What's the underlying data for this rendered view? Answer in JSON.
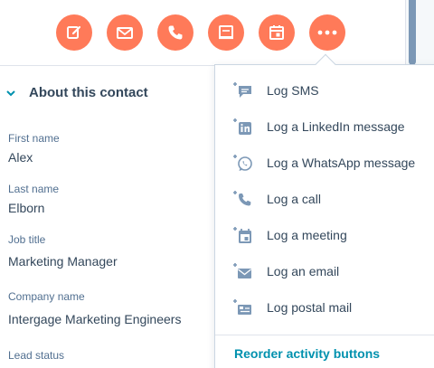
{
  "action_buttons": [
    {
      "name": "note",
      "icon": "note-icon"
    },
    {
      "name": "email",
      "icon": "email-icon"
    },
    {
      "name": "call",
      "icon": "phone-icon"
    },
    {
      "name": "task",
      "icon": "task-icon"
    },
    {
      "name": "meeting",
      "icon": "meeting-icon"
    },
    {
      "name": "more",
      "icon": "more-icon"
    }
  ],
  "colors": {
    "accent": "#ff7a59",
    "icon_slate": "#7c98b6",
    "link": "#0091ae",
    "text": "#33475b"
  },
  "about": {
    "title": "About this contact",
    "fields": [
      {
        "label": "First name",
        "value": "Alex"
      },
      {
        "label": "Last name",
        "value": "Elborn"
      },
      {
        "label": "Job title",
        "value": "Marketing Manager"
      },
      {
        "label": "Company name",
        "value": "Intergage Marketing Engineers"
      },
      {
        "label": "Lead status",
        "value": ""
      }
    ]
  },
  "menu": {
    "items": [
      {
        "label": "Log SMS",
        "icon": "sms-icon"
      },
      {
        "label": "Log a LinkedIn message",
        "icon": "linkedin-icon"
      },
      {
        "label": "Log a WhatsApp message",
        "icon": "whatsapp-icon"
      },
      {
        "label": "Log a call",
        "icon": "phone-icon"
      },
      {
        "label": "Log a meeting",
        "icon": "meeting-icon"
      },
      {
        "label": "Log an email",
        "icon": "email-icon"
      },
      {
        "label": "Log postal mail",
        "icon": "postal-mail-icon"
      }
    ],
    "footer_link": "Reorder activity buttons"
  }
}
